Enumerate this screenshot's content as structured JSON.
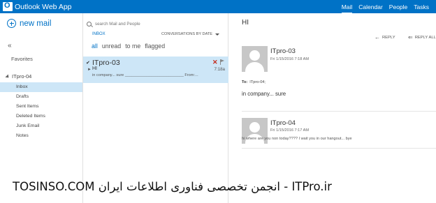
{
  "app": {
    "title": "Outlook Web App"
  },
  "topnav": {
    "items": [
      "Mail",
      "Calendar",
      "People",
      "Tasks"
    ],
    "active": "Mail"
  },
  "leftnav": {
    "new_mail": "new mail",
    "collapse": "«",
    "favorites": "Favorites",
    "account": "ITpro-04",
    "folders": [
      "Inbox",
      "Drafts",
      "Sent Items",
      "Deleted Items",
      "Junk Email",
      "Notes"
    ],
    "selected_folder": "Inbox"
  },
  "maillist": {
    "search_placeholder": "search Mail and People",
    "folder_label": "INBOX",
    "sort_label": "CONVERSATIONS BY DATE",
    "filters": [
      "all",
      "unread",
      "to me",
      "flagged"
    ],
    "active_filter": "all",
    "messages": [
      {
        "check": "✔",
        "sender": "ITpro-03",
        "delete_glyph": "✕",
        "arrow": "►",
        "subject": "HI",
        "time": "7:18a",
        "preview": "in company... sure ___________________________ From:..."
      }
    ]
  },
  "reading": {
    "subject": "HI",
    "reply_label": "REPLY",
    "reply_all_label": "REPLY ALL",
    "messages": [
      {
        "sender": "ITpro-03",
        "date": "Fri 1/15/2016 7:18 AM",
        "to_label": "To:",
        "to": "ITpro-04;",
        "body": "in company... sure"
      },
      {
        "sender": "ITpro-04",
        "date": "Fri 1/15/2016 7:17 AM",
        "body": "hi where are you non today???? I wait you in our hangout... bye"
      }
    ]
  },
  "watermark": {
    "text": "TOSINSO.COM انجمن تخصصی فناوری اطلاعات ایران - ITPro.ir"
  },
  "colors": {
    "accent": "#0072c6",
    "selected": "#cde6f7",
    "delete": "#c42b1c"
  }
}
